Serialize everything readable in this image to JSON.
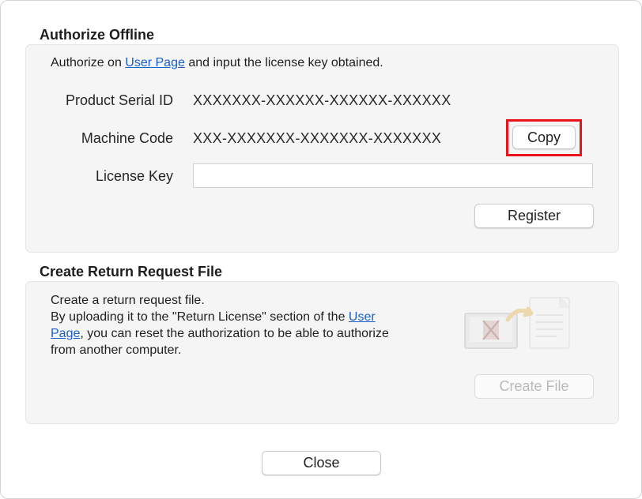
{
  "authorize": {
    "title": "Authorize Offline",
    "instruction_prefix": "Authorize on ",
    "instruction_link": "User Page",
    "instruction_suffix": " and input the license key obtained.",
    "serial_label": "Product Serial ID",
    "serial_value": "XXXXXXX-XXXXXX-XXXXXX-XXXXXX",
    "machine_label": "Machine Code",
    "machine_value": "XXX-XXXXXXX-XXXXXXX-XXXXXXX",
    "copy_label": "Copy",
    "license_label": "License Key",
    "license_value": "",
    "register_label": "Register"
  },
  "return_request": {
    "title": "Create Return Request File",
    "line1": "Create a return request file.",
    "line2_prefix": "By uploading it to the \"Return License\" section of the ",
    "line2_link": "User",
    "line3_link": "Page",
    "line3_suffix": ", you can reset the authorization to be able to authorize",
    "line4": "from another computer.",
    "create_label": "Create File",
    "illustration_icon": "return-license-illustration-icon"
  },
  "footer": {
    "close_label": "Close"
  },
  "colors": {
    "link": "#1a5fc8",
    "highlight": "#e8131b",
    "panel": "#f5f5f5"
  }
}
